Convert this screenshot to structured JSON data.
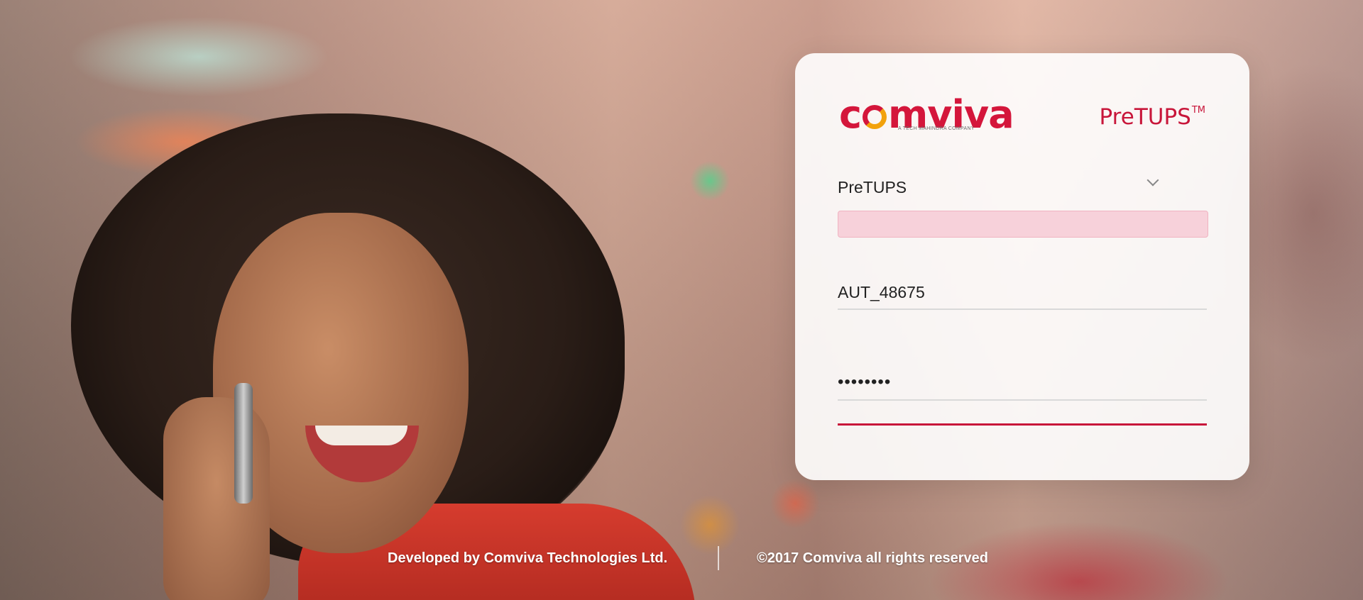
{
  "brand": {
    "logo_text": "comviva",
    "logo_tagline": "A TECH MAHINDRA COMPANY",
    "product_name": "PreTUPS",
    "product_mark": "TM",
    "primary_color": "#c8163a",
    "accent_color": "#f2a20c"
  },
  "login": {
    "network_select": {
      "value": "PreTUPS",
      "icon": "chevron-down-icon"
    },
    "error_message": "",
    "username": {
      "value": "AUT_48675"
    },
    "password": {
      "value": "••••••••"
    }
  },
  "footer": {
    "developer": "Developed by Comviva Technologies Ltd.",
    "copyright": "©2017 Comviva all rights reserved"
  }
}
